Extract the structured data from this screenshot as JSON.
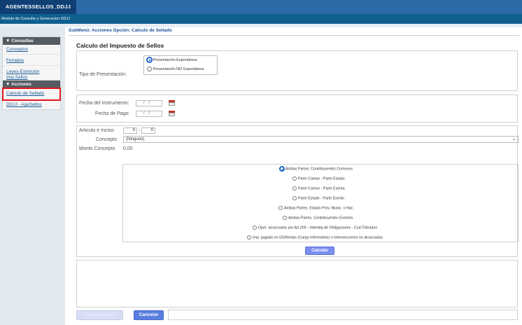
{
  "header": {
    "app_title": "AGENTESSELLOS_DDJJ",
    "subtitle": "Modulo de Consulta y Generacion DDJJ"
  },
  "sidebar": {
    "consultas_title": "▼ Consultas",
    "consultas_items": [
      "Conceptos",
      "Feriados",
      "Leyes-Eximición",
      "Imp.Sellos"
    ],
    "acciones_title": "▼ Acciones",
    "acciones_items": [
      "Calculo de Sellado",
      "DDJJ - AgeSellos"
    ]
  },
  "main": {
    "submenu": "SubMenú: Acciones Opción: Calculo de Sellado",
    "title": "Calculo del Impuesto de Sellos",
    "presentacion": {
      "label": "Tipo de Presentación:",
      "options": [
        "Presentación Espontánea",
        "Presentación NO Espontánea"
      ],
      "selected": 0
    },
    "fechas": {
      "instrumento_label": "Fecha del Instrumento:",
      "pago_label": "Fecha de Pago:",
      "placeholder": "/ /"
    },
    "articulo": {
      "label": "Articulo e Inciso:",
      "articulo_value": "0",
      "separator": "-",
      "inciso_value": "0"
    },
    "concepto": {
      "label": "Concepto",
      "selected": "(Ninguno)"
    },
    "monto": {
      "label": "Monto Concepto",
      "value": "0,00"
    },
    "partes_options": [
      "Ambas Partes. Contribuyentes Comunes",
      "Parte Comun - Parte Estado",
      "Parte Comun - Parte Exenta",
      "Parte Estado - Parte Exento",
      "Ambas Partes. Estado Prov. Munic. o Nac.",
      "Ambas Partes. Contribuyentes Exentos",
      "Oper. alcanzadas por Art.200 - Interdep.de Obligaciones - Cod.Tributario",
      "Imp. pagado en DGRentas (Carga Informativa) o Intervenciones no alcanzadas"
    ],
    "partes_selected": 0,
    "calcular_button": "Calcular",
    "disabled_button": "Aceptar Cálculo",
    "cancel_button": "Cancelar"
  },
  "colors": {
    "header_dark": "#0f3f74",
    "header_blue": "#2b6aa6",
    "active_outline": "#e3161c",
    "button_blue": "#5a7fe0"
  }
}
